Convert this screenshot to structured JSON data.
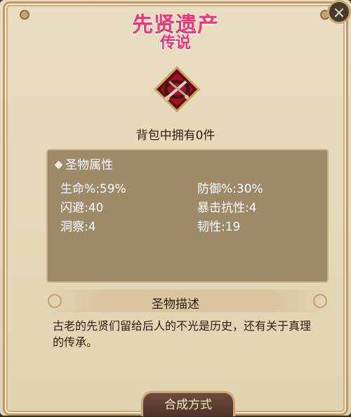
{
  "item": {
    "name": "先贤遗产",
    "rarity": "传说",
    "owned_text": "背包中拥有0件",
    "icon": "relic-cross-swords-icon"
  },
  "attributes": {
    "header": "圣物属性",
    "items": [
      {
        "text": "生命%:59%"
      },
      {
        "text": "防御%:30%"
      },
      {
        "text": "闪避:40"
      },
      {
        "text": "暴击抗性:4"
      },
      {
        "text": "洞察:4"
      },
      {
        "text": "韧性:19"
      }
    ]
  },
  "description": {
    "header": "圣物描述",
    "text": "古老的先贤们留给后人的不光是历史，还有关于真理的传承。"
  },
  "buttons": {
    "craft_label": "合成方式",
    "close_label": "×"
  },
  "colors": {
    "title": "#ff2f6a",
    "panel": "#e6d8b8",
    "attr_box": "#9d8a69"
  }
}
